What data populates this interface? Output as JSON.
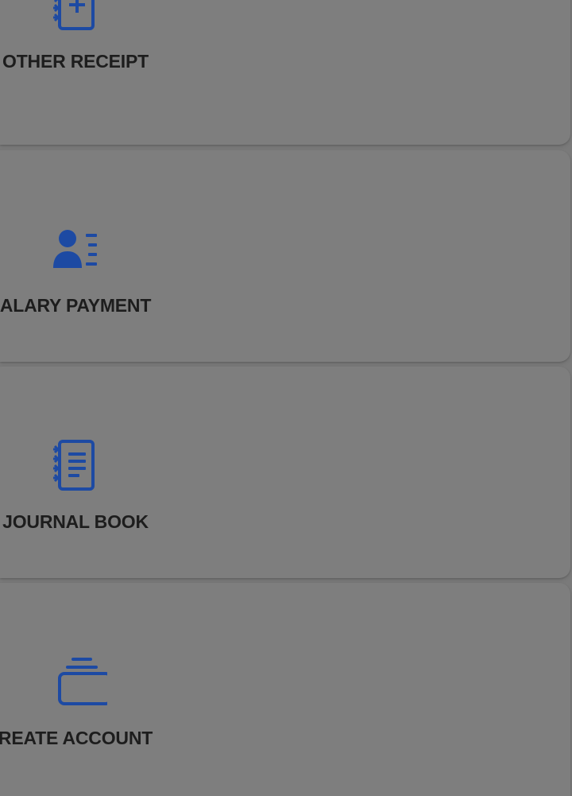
{
  "menu": {
    "items": [
      {
        "label": "OTHER RECEIPT",
        "icon": "notebook-plus-icon"
      },
      {
        "label": "ALARY PAYMENT",
        "icon": "user-list-icon"
      },
      {
        "label": "JOURNAL BOOK",
        "icon": "notebook-lines-icon"
      },
      {
        "label": "REATE ACCOUNT",
        "icon": "card-stack-icon"
      }
    ]
  },
  "colors": {
    "icon_accent": "#1d4aa3",
    "label_text": "#1d1d1d",
    "overlay_background": "#7d7d7d"
  }
}
